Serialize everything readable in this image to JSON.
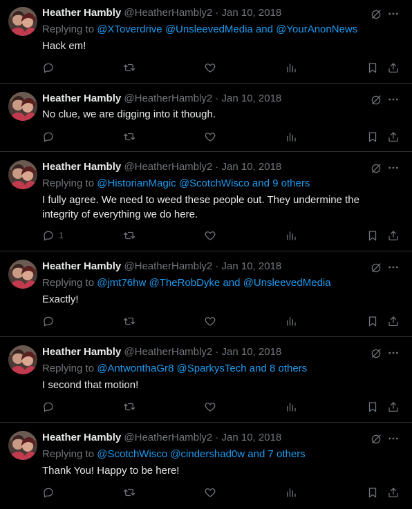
{
  "tweets": [
    {
      "name": "Heather Hambly",
      "handle": "@HeatherHambly2",
      "sep": "·",
      "date": "Jan 10, 2018",
      "replying_prefix": "Replying to",
      "mentions": [
        "@XToverdrive",
        "@UnsleevedMedia"
      ],
      "mention_joiner": "and",
      "last_mention": "@YourAnonNews",
      "text": "Hack em!",
      "reply_count": ""
    },
    {
      "name": "Heather Hambly",
      "handle": "@HeatherHambly2",
      "sep": "·",
      "date": "Jan 10, 2018",
      "text": "No clue, we are digging into it though.",
      "reply_count": ""
    },
    {
      "name": "Heather Hambly",
      "handle": "@HeatherHambly2",
      "sep": "·",
      "date": "Jan 10, 2018",
      "replying_prefix": "Replying to",
      "mentions": [
        "@HistorianMagic",
        "@ScotchWisco"
      ],
      "mention_joiner": "and",
      "last_mention": "9 others",
      "text": "I fully agree. We need to weed these people out. They undermine the integrity of everything we do here.",
      "reply_count": "1"
    },
    {
      "name": "Heather Hambly",
      "handle": "@HeatherHambly2",
      "sep": "·",
      "date": "Jan 10, 2018",
      "replying_prefix": "Replying to",
      "mentions": [
        "@jmt76hw",
        "@TheRobDyke"
      ],
      "mention_joiner": "and",
      "last_mention": "@UnsleevedMedia",
      "text": "Exactly!",
      "reply_count": ""
    },
    {
      "name": "Heather Hambly",
      "handle": "@HeatherHambly2",
      "sep": "·",
      "date": "Jan 10, 2018",
      "replying_prefix": "Replying to",
      "mentions": [
        "@AntwonthaGr8",
        "@SparkysTech"
      ],
      "mention_joiner": "and",
      "last_mention": "8 others",
      "text": "I second that motion!",
      "reply_count": ""
    },
    {
      "name": "Heather Hambly",
      "handle": "@HeatherHambly2",
      "sep": "·",
      "date": "Jan 10, 2018",
      "replying_prefix": "Replying to",
      "mentions": [
        "@ScotchWisco",
        "@cindershad0w"
      ],
      "mention_joiner": "and",
      "last_mention": "7 others",
      "text": "Thank You! Happy to be here!",
      "reply_count": ""
    }
  ],
  "icons": {
    "grok": "grok-icon",
    "more": "more-icon",
    "reply": "reply-icon",
    "retweet": "retweet-icon",
    "like": "like-icon",
    "views": "views-icon",
    "bookmark": "bookmark-icon",
    "share": "share-icon"
  },
  "colors": {
    "background": "#000000",
    "text": "#e7e9ea",
    "muted": "#71767b",
    "link": "#1d9bf0",
    "divider": "#2f3336"
  }
}
